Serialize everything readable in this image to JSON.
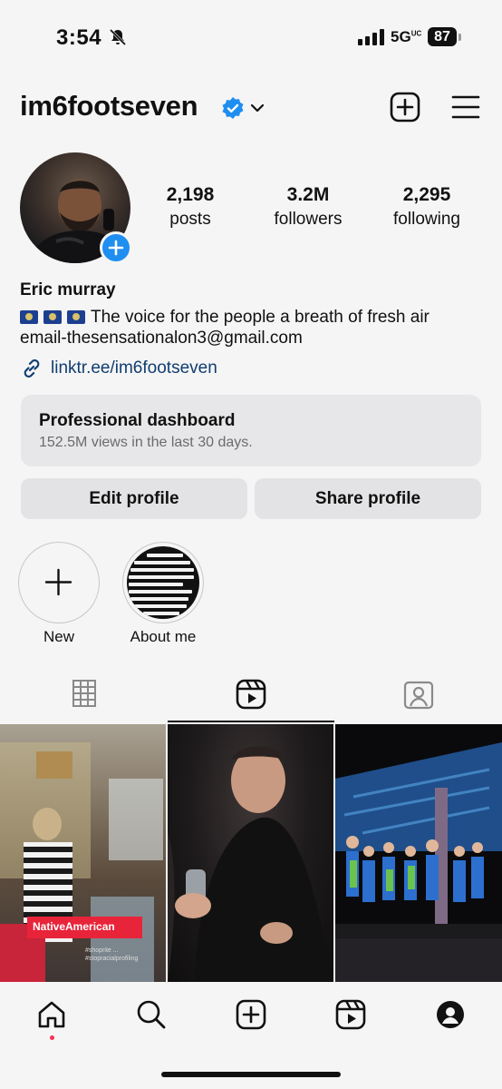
{
  "status_bar": {
    "time": "3:54",
    "network": "5G",
    "network_sup": "UC",
    "battery": "87"
  },
  "header": {
    "username": "im6footseven",
    "verified": true,
    "create_icon": "plus-square-icon",
    "menu_icon": "hamburger-menu-icon"
  },
  "profile": {
    "stats": [
      {
        "value": "2,198",
        "label": "posts"
      },
      {
        "value": "3.2M",
        "label": "followers"
      },
      {
        "value": "2,295",
        "label": "following"
      }
    ],
    "name": "Eric murray",
    "bio_text": "The voice for the people a breath of fresh air",
    "bio_flags": 3,
    "email": "email-thesensationalon3@gmail.com",
    "link": "linktr.ee/im6footseven"
  },
  "dashboard": {
    "title": "Professional dashboard",
    "subtitle": "152.5M views in the last 30 days."
  },
  "buttons": {
    "edit": "Edit profile",
    "share": "Share profile"
  },
  "highlights": [
    {
      "label": "New"
    },
    {
      "label": "About me"
    }
  ],
  "tabs": {
    "active": "reels",
    "items": [
      "grid-icon",
      "reels-icon",
      "tagged-icon"
    ]
  },
  "posts": [
    {
      "overlay_text": "NativeAmerican",
      "caption": "#shoprite ... #stopracialprofiling"
    },
    {
      "overlay_text": ""
    },
    {
      "overlay_text": ""
    }
  ],
  "colors": {
    "accent": "#1f8ef1",
    "link": "#103d70",
    "background": "#f5f5f5",
    "card": "#e7e7e9"
  },
  "bottom_nav": {
    "items": [
      "home-icon",
      "search-icon",
      "create-icon",
      "reels-icon",
      "profile-icon"
    ],
    "active": "home"
  }
}
